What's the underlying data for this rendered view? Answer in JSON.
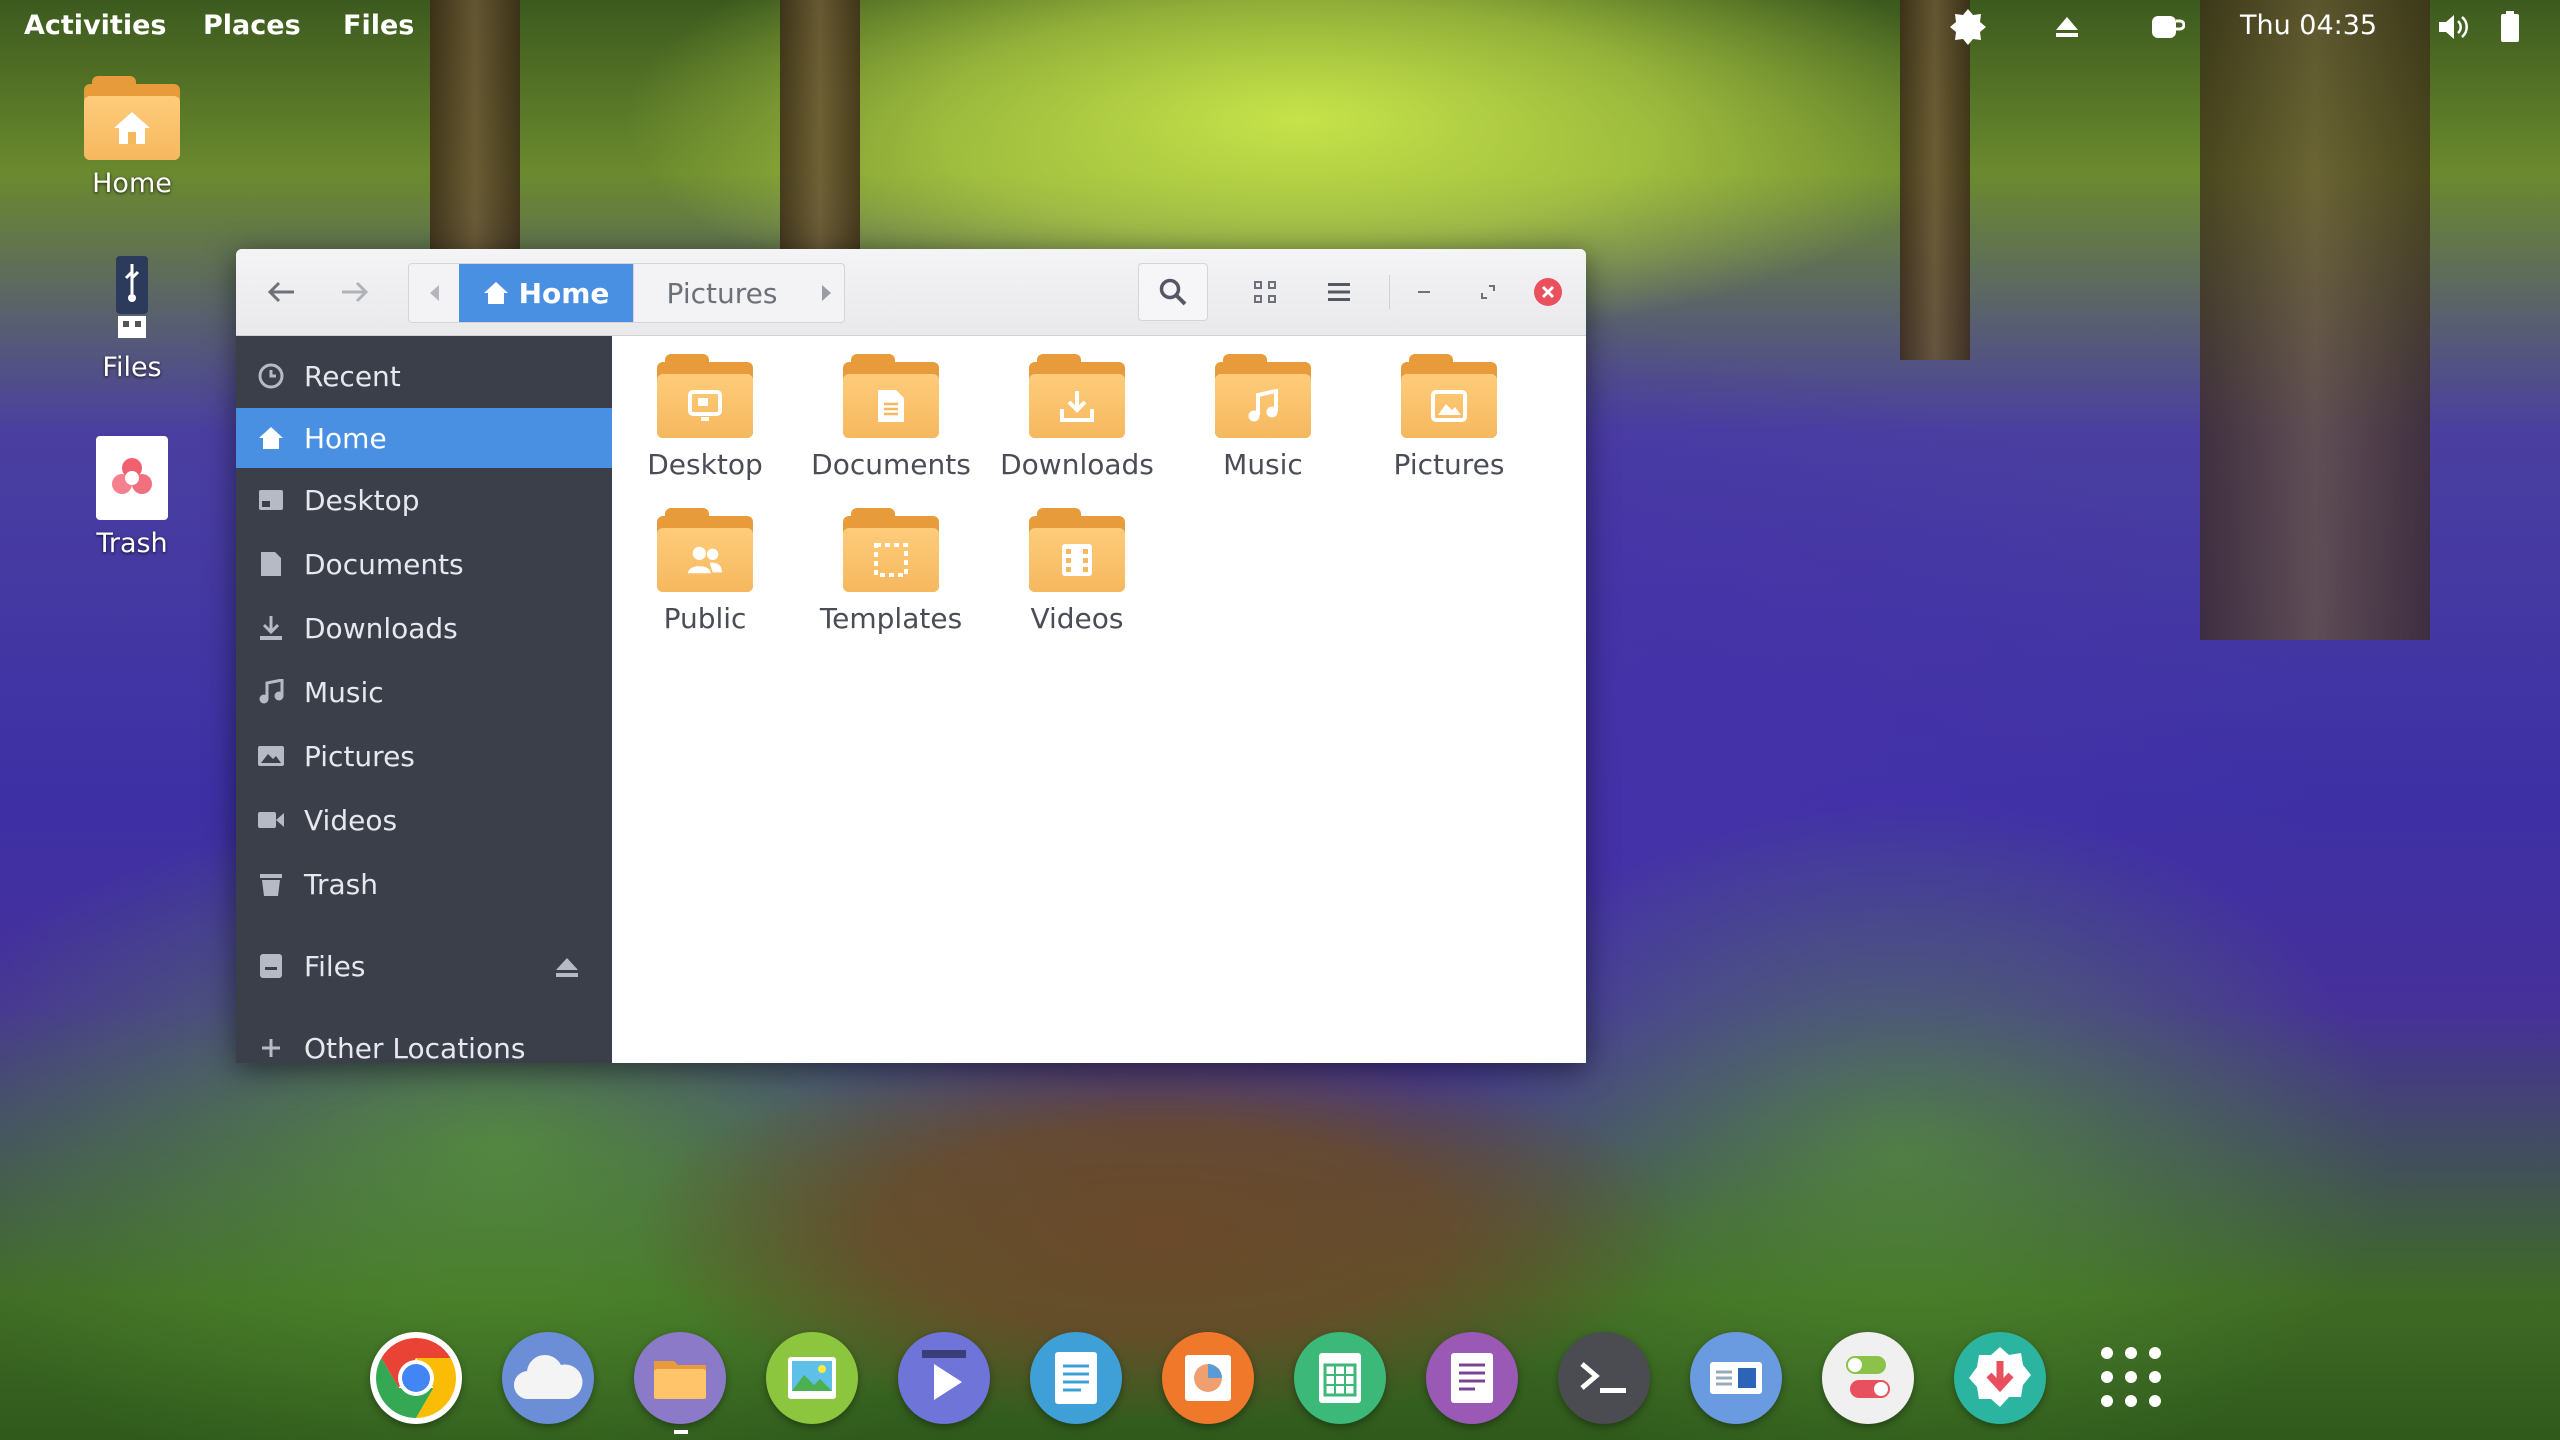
{
  "topbar": {
    "activities": "Activities",
    "places": "Places",
    "app_menu": "Files",
    "clock": "Thu 04:35"
  },
  "desktop_icons": [
    {
      "label": "Home"
    },
    {
      "label": "Files"
    },
    {
      "label": "Trash"
    }
  ],
  "window": {
    "pathbar": {
      "current": "Home",
      "next": "Pictures"
    },
    "sidebar": {
      "items": [
        {
          "label": "Recent",
          "icon": "clock-icon"
        },
        {
          "label": "Home",
          "icon": "home-icon",
          "active": true
        },
        {
          "label": "Desktop",
          "icon": "desktop-icon"
        },
        {
          "label": "Documents",
          "icon": "document-icon"
        },
        {
          "label": "Downloads",
          "icon": "download-icon"
        },
        {
          "label": "Music",
          "icon": "music-icon"
        },
        {
          "label": "Pictures",
          "icon": "picture-icon"
        },
        {
          "label": "Videos",
          "icon": "video-icon"
        },
        {
          "label": "Trash",
          "icon": "trash-icon"
        }
      ],
      "devices": [
        {
          "label": "Files",
          "icon": "drive-icon"
        }
      ],
      "other": {
        "label": "Other Locations"
      }
    },
    "folders": [
      {
        "label": "Desktop",
        "icon": "desktop-icon"
      },
      {
        "label": "Documents",
        "icon": "document-icon"
      },
      {
        "label": "Downloads",
        "icon": "download-icon"
      },
      {
        "label": "Music",
        "icon": "music-icon"
      },
      {
        "label": "Pictures",
        "icon": "picture-icon"
      },
      {
        "label": "Public",
        "icon": "people-icon"
      },
      {
        "label": "Templates",
        "icon": "template-icon"
      },
      {
        "label": "Videos",
        "icon": "video-icon"
      }
    ]
  },
  "dock": [
    {
      "name": "chrome",
      "color": "#ffffff"
    },
    {
      "name": "cloud",
      "color": "#6b8ed6"
    },
    {
      "name": "files",
      "color": "#8a7ac8"
    },
    {
      "name": "image-viewer",
      "color": "#8cc63f"
    },
    {
      "name": "video-player",
      "color": "#6e74d8"
    },
    {
      "name": "text-editor",
      "color": "#3fa0d8"
    },
    {
      "name": "presentation",
      "color": "#f0782a"
    },
    {
      "name": "spreadsheet",
      "color": "#3cb878"
    },
    {
      "name": "document-writer",
      "color": "#9b59b6"
    },
    {
      "name": "terminal",
      "color": "#4a4c52"
    },
    {
      "name": "display-settings",
      "color": "#6a9ae0"
    },
    {
      "name": "tweaks",
      "color": "#f0f0f0"
    },
    {
      "name": "software-center",
      "color": "#2bb5a0"
    },
    {
      "name": "app-grid",
      "color": "transparent"
    }
  ]
}
